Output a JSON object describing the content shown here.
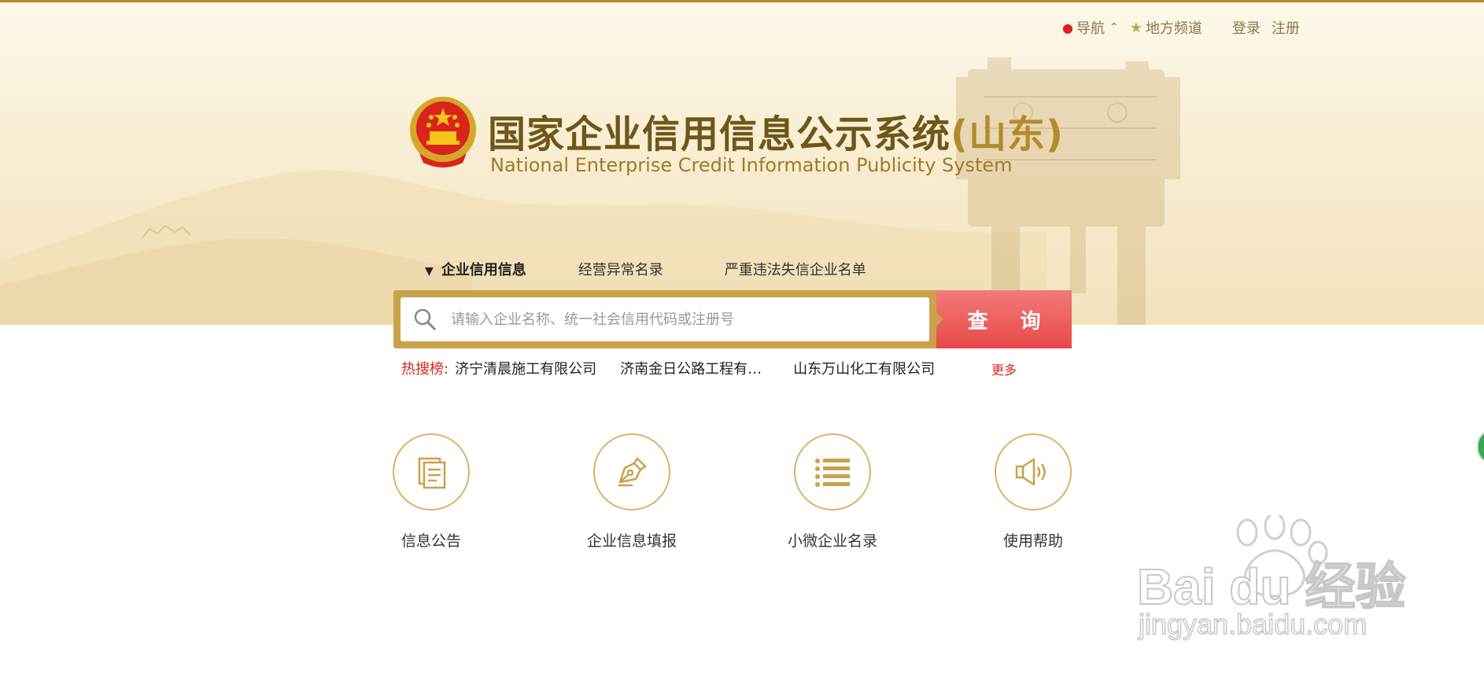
{
  "topnav": {
    "nav_label": "导航",
    "local_label": "地方频道",
    "login_label": "登录",
    "register_label": "注册"
  },
  "header": {
    "title_cn": "国家企业信用信息公示系统",
    "title_province": "(山东)",
    "title_en": "National Enterprise Credit Information Publicity System"
  },
  "tabs": [
    {
      "label": "企业信用信息",
      "active": true
    },
    {
      "label": "经营异常名录",
      "active": false
    },
    {
      "label": "严重违法失信企业名单",
      "active": false
    }
  ],
  "search": {
    "placeholder": "请输入企业名称、统一社会信用代码或注册号",
    "button_label": "查 询"
  },
  "hot": {
    "label": "热搜榜:",
    "items": [
      "济宁清晨施工有限公司",
      "济南金日公路工程有限...",
      "山东万山化工有限公司"
    ],
    "more_label": "更多"
  },
  "features": [
    {
      "label": "信息公告",
      "icon": "document-icon"
    },
    {
      "label": "企业信息填报",
      "icon": "pen-icon"
    },
    {
      "label": "小微企业名录",
      "icon": "list-icon"
    },
    {
      "label": "使用帮助",
      "icon": "speaker-icon"
    }
  ],
  "watermark": {
    "brand": "Bai du 经验",
    "url": "jingyan.baidu.com"
  },
  "colors": {
    "gold": "#c9a24a",
    "red": "#e8484a",
    "title_brown": "#6e5718"
  }
}
